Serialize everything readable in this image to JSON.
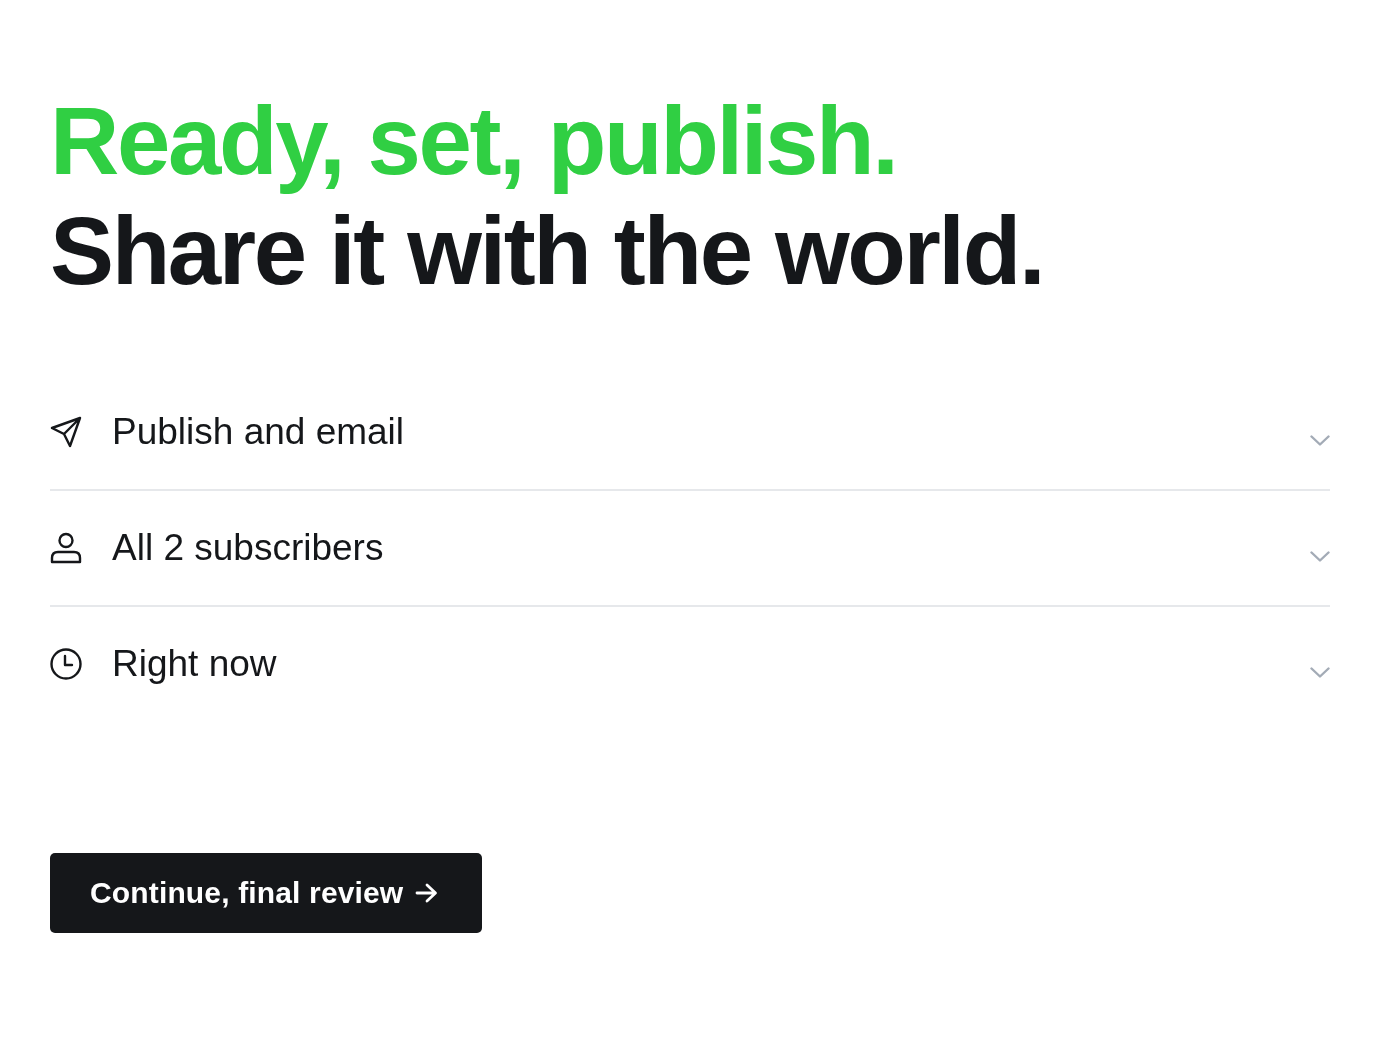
{
  "headline": {
    "highlight": "Ready, set, publish.",
    "subtitle": "Share it with the world."
  },
  "options": [
    {
      "kind": "publish",
      "label": "Publish and email",
      "expanded": false
    },
    {
      "kind": "audience",
      "label": "All 2 subscribers",
      "expanded": false
    },
    {
      "kind": "schedule",
      "label": "Right now",
      "expanded": false
    }
  ],
  "button": {
    "label": "Continue, final review"
  }
}
